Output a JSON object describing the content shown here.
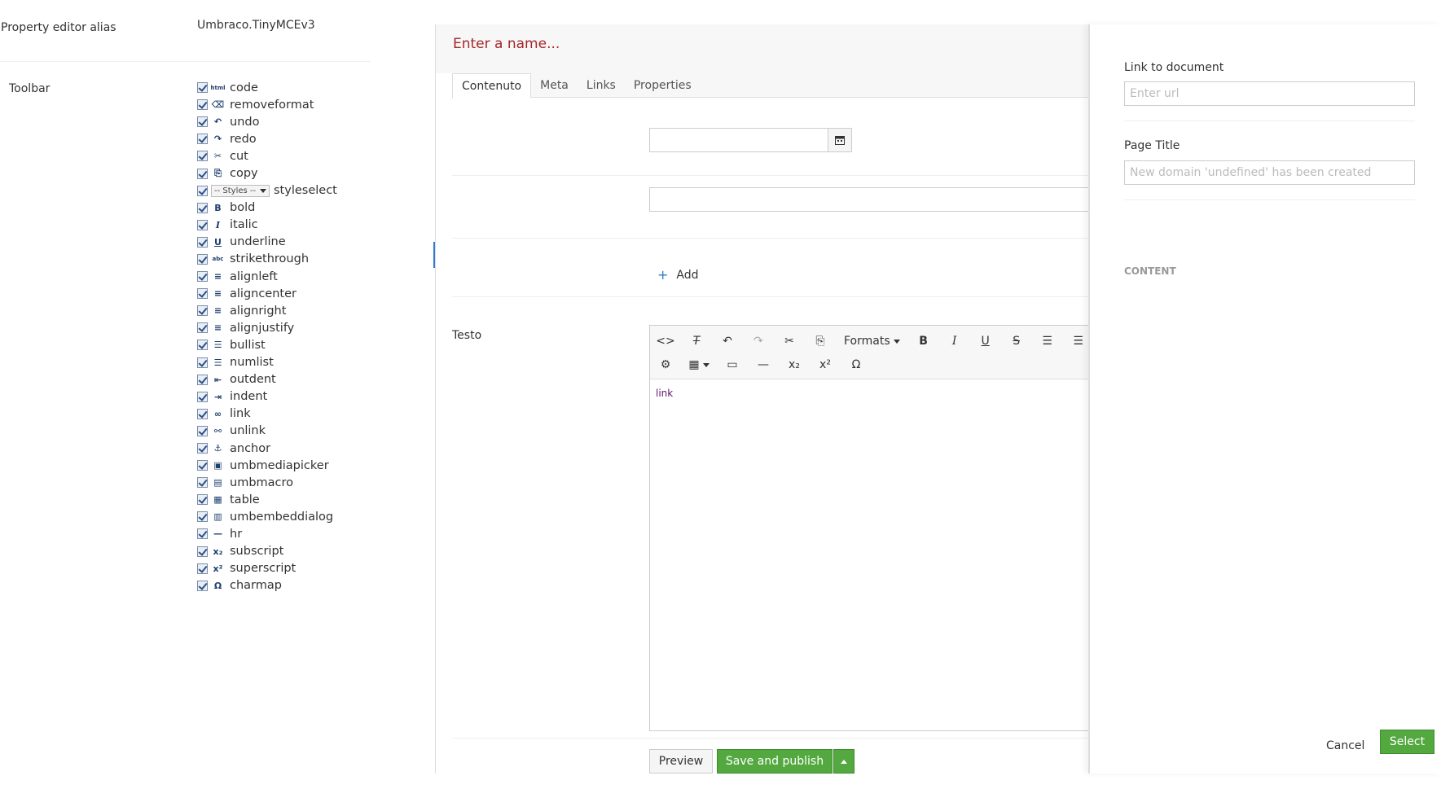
{
  "settings": {
    "alias_label": "Property editor alias",
    "alias_value": "Umbraco.TinyMCEv3",
    "toolbar_label": "Toolbar",
    "toolbar_items": [
      {
        "label": "code",
        "icon": "html-icon",
        "glyph": "html"
      },
      {
        "label": "removeformat",
        "icon": "eraser-icon",
        "glyph": "⌫"
      },
      {
        "label": "undo",
        "icon": "undo-icon",
        "glyph": "↶"
      },
      {
        "label": "redo",
        "icon": "redo-icon",
        "glyph": "↷"
      },
      {
        "label": "cut",
        "icon": "scissors-icon",
        "glyph": "✂"
      },
      {
        "label": "copy",
        "icon": "copy-icon",
        "glyph": "⎘"
      },
      {
        "label": "styleselect",
        "icon": "styles-select",
        "glyph": "",
        "select_text": "-- Styles --"
      },
      {
        "label": "bold",
        "icon": "bold-icon",
        "glyph": "B"
      },
      {
        "label": "italic",
        "icon": "italic-icon",
        "glyph": "I"
      },
      {
        "label": "underline",
        "icon": "underline-icon",
        "glyph": "U"
      },
      {
        "label": "strikethrough",
        "icon": "strikethrough-icon",
        "glyph": "abc"
      },
      {
        "label": "alignleft",
        "icon": "align-left-icon",
        "glyph": "≡"
      },
      {
        "label": "aligncenter",
        "icon": "align-center-icon",
        "glyph": "≡"
      },
      {
        "label": "alignright",
        "icon": "align-right-icon",
        "glyph": "≡"
      },
      {
        "label": "alignjustify",
        "icon": "align-justify-icon",
        "glyph": "≡"
      },
      {
        "label": "bullist",
        "icon": "bullet-list-icon",
        "glyph": "☰"
      },
      {
        "label": "numlist",
        "icon": "numbered-list-icon",
        "glyph": "☰"
      },
      {
        "label": "outdent",
        "icon": "outdent-icon",
        "glyph": "⇤"
      },
      {
        "label": "indent",
        "icon": "indent-icon",
        "glyph": "⇥"
      },
      {
        "label": "link",
        "icon": "link-icon",
        "glyph": "∞"
      },
      {
        "label": "unlink",
        "icon": "unlink-icon",
        "glyph": "⚯"
      },
      {
        "label": "anchor",
        "icon": "anchor-icon",
        "glyph": "⚓"
      },
      {
        "label": "umbmediapicker",
        "icon": "image-icon",
        "glyph": "▣"
      },
      {
        "label": "umbmacro",
        "icon": "macro-icon",
        "glyph": "▤"
      },
      {
        "label": "table",
        "icon": "table-icon",
        "glyph": "▦"
      },
      {
        "label": "umbembeddialog",
        "icon": "embed-icon",
        "glyph": "▥"
      },
      {
        "label": "hr",
        "icon": "hr-icon",
        "glyph": "—"
      },
      {
        "label": "subscript",
        "icon": "subscript-icon",
        "glyph": "x₂"
      },
      {
        "label": "superscript",
        "icon": "superscript-icon",
        "glyph": "x²"
      },
      {
        "label": "charmap",
        "icon": "omega-icon",
        "glyph": "Ω"
      }
    ]
  },
  "editor": {
    "name_placeholder": "Enter a name...",
    "tabs": [
      "Contenuto",
      "Meta",
      "Links",
      "Properties"
    ],
    "add_label": "Add",
    "testo_label": "Testo",
    "rte_formats": "Formats",
    "rte_content": "link",
    "preview_label": "Preview",
    "save_label": "Save and publish"
  },
  "dialog": {
    "link_label": "Link to document",
    "link_placeholder": "Enter url",
    "title_label": "Page Title",
    "title_placeholder": "New domain 'undefined' has been created",
    "section_label": "CONTENT",
    "cancel_label": "Cancel",
    "select_label": "Select"
  },
  "colors": {
    "accent_green": "#53a93f",
    "name_red": "#a5262a",
    "accent_blue": "#2e7bd4"
  }
}
